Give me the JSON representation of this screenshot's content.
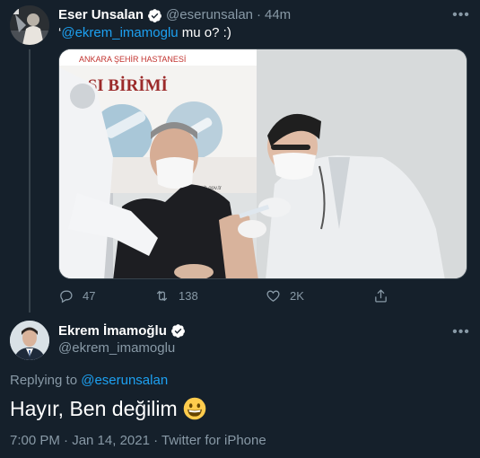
{
  "tweet1": {
    "display_name": "Eser Unsalan",
    "handle": "@eserunsalan",
    "separator": "·",
    "time": "44m",
    "more_label": "•••",
    "quote_prefix": "‘",
    "mention": "@ekrem_imamoglu",
    "text_rest": " mu o? :)",
    "photo": {
      "sign_top": "ANKARA ŞEHİR HASTANESİ",
      "sign_main": "AŞI BİRİMİ",
      "sign_small": "tuseb.gov.tr"
    },
    "actions": {
      "reply_count": "47",
      "retweet_count": "138",
      "like_count": "2K"
    }
  },
  "tweet2": {
    "display_name": "Ekrem İmamoğlu",
    "handle": "@ekrem_imamoglu",
    "more_label": "•••",
    "replying_prefix": "Replying to ",
    "replying_handle": "@eserunsalan",
    "text": "Hayır, Ben değilim",
    "meta": "7:00 PM · Jan 14, 2021 · Twitter for iPhone"
  },
  "colors": {
    "background": "#15202b",
    "accent": "#1da1f2",
    "muted": "#8899a6"
  }
}
